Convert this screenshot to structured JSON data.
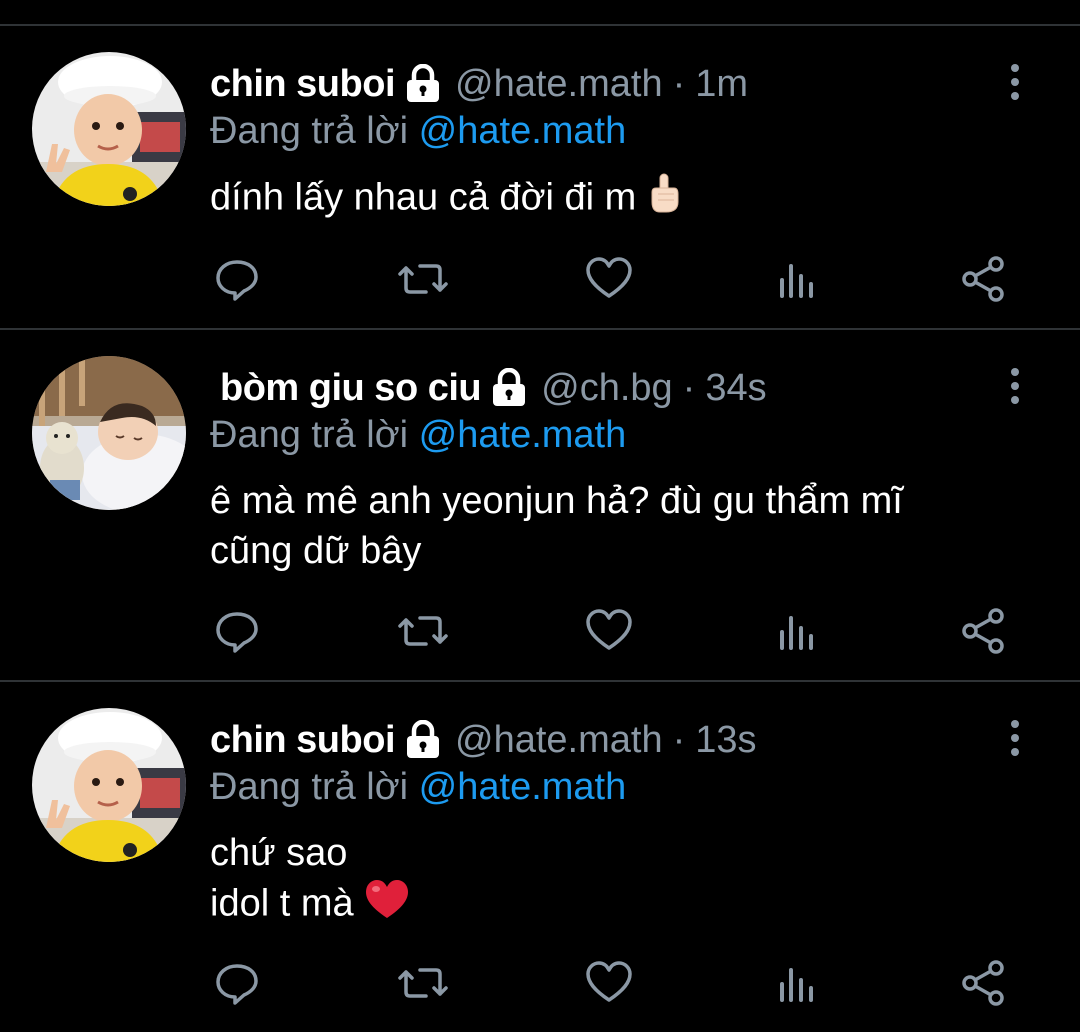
{
  "reply_prefix": "Đang trả lời",
  "tweets": [
    {
      "display_name": "chin suboi",
      "handle": "@hate.math",
      "dot": "·",
      "time": "1m",
      "reply_to": "@hate.math",
      "text_lines": [
        "dính lấy nhau cả đời đi m"
      ],
      "emoji": "pointing-up-hand"
    },
    {
      "display_name": "bòm giu so ciu",
      "handle": "@ch.bg",
      "dot": "·",
      "time": "34s",
      "reply_to": "@hate.math",
      "text_lines": [
        "ê mà mê anh yeonjun hả? đù gu thẩm mĩ",
        "cũng dữ bây"
      ],
      "emoji": ""
    },
    {
      "display_name": "chin suboi",
      "handle": "@hate.math",
      "dot": "·",
      "time": "13s",
      "reply_to": "@hate.math",
      "text_lines": [
        "chứ sao",
        "idol t mà"
      ],
      "emoji": "red-heart"
    }
  ],
  "icons": {
    "reply": "reply-icon",
    "retweet": "retweet-icon",
    "like": "heart-icon",
    "views": "views-icon",
    "share": "share-icon",
    "more": "more-vertical-icon",
    "lock": "lock-icon"
  },
  "colors": {
    "background": "#000000",
    "divider": "#2f3336",
    "secondary_text": "#8b98a5",
    "link": "#1d9bf0",
    "heart_emoji": "#e0203a"
  }
}
